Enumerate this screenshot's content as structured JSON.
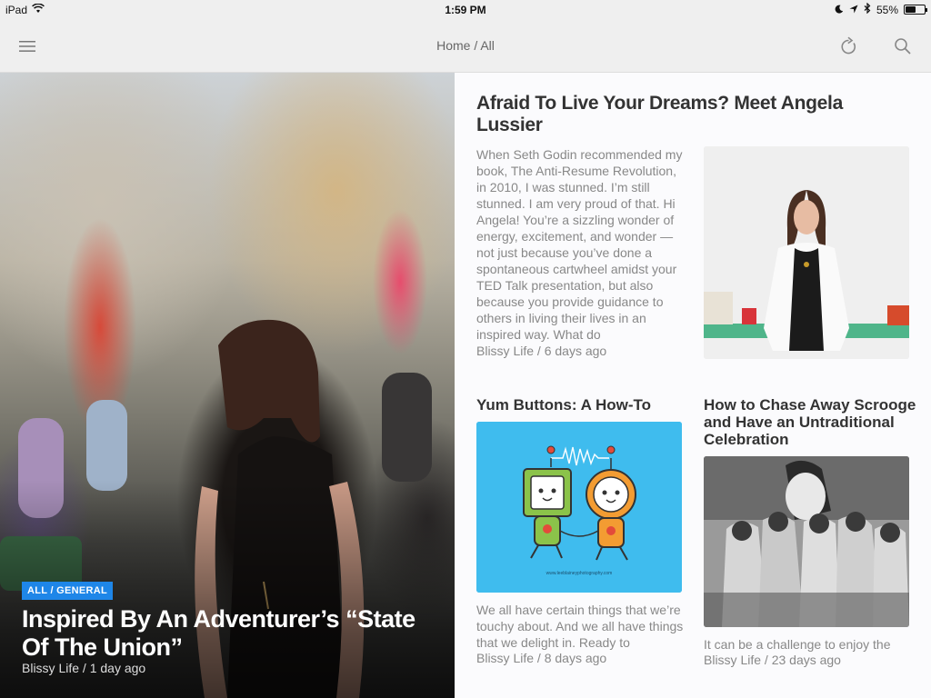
{
  "status_bar": {
    "device": "iPad",
    "time": "1:59 PM",
    "battery": "55%",
    "battery_level": 0.55
  },
  "nav": {
    "title": "Home / All",
    "menu_icon": "hamburger-menu-icon",
    "refresh_icon": "refresh-icon",
    "search_icon": "search-icon"
  },
  "hero": {
    "badge": "ALL / GENERAL",
    "title": "Inspired By An Adventurer’s “State Of The Union”",
    "meta": "Blissy Life / 1 day ago",
    "badge_color": "#1e86e8"
  },
  "articles": [
    {
      "title": "Afraid To Live Your Dreams? Meet Angela Lussier",
      "excerpt": "When Seth Godin recommended my book, The Anti-Resume Revolution, in 2010, I was stunned. I’m still stunned. I am very proud of that. Hi Angela! You’re a sizzling wonder of energy, excitement, and wonder — not just because you’ve done a spontaneous cartwheel amidst your TED Talk presentation, but also because you provide guidance to others in living their lives in an inspired way. What do",
      "meta": "Blissy Life / 6 days ago"
    },
    {
      "title": "Yum Buttons: A How-To",
      "excerpt": "We all have certain things that we’re touchy about. And we all have things that we delight in. Ready to",
      "meta": "Blissy Life / 8 days ago",
      "image_caption": "www.leeblaineyphotography.com"
    },
    {
      "title": "How to Chase Away Scrooge and Have an Untraditional Celebration",
      "excerpt": "It can be a challenge to enjoy the",
      "meta": "Blissy Life / 23 days ago"
    }
  ]
}
